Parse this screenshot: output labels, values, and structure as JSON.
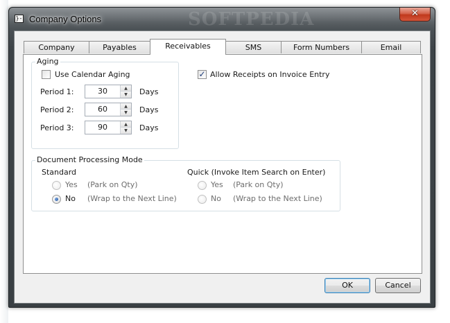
{
  "window": {
    "title": "Company Options",
    "icon": "app-icon",
    "icon_glyph": "}-",
    "watermark": "SOFTPEDIA",
    "close_glyph": "✕"
  },
  "tabs": [
    {
      "label": "Company"
    },
    {
      "label": "Payables"
    },
    {
      "label": "Receivables"
    },
    {
      "label": "SMS"
    },
    {
      "label": "Form Numbers"
    },
    {
      "label": "Email"
    }
  ],
  "active_tab": "Receivables",
  "aging": {
    "group_label": "Aging",
    "use_calendar_aging": {
      "label": "Use Calendar Aging",
      "checked": false
    },
    "periods": [
      {
        "label": "Period 1:",
        "value": "30",
        "unit": "Days"
      },
      {
        "label": "Period 2:",
        "value": "60",
        "unit": "Days"
      },
      {
        "label": "Period 3:",
        "value": "90",
        "unit": "Days"
      }
    ]
  },
  "allow_receipts": {
    "label": "Allow Receipts on Invoice Entry",
    "checked": true,
    "check_glyph": "✓"
  },
  "doc_mode": {
    "group_label": "Document Processing Mode",
    "standard": {
      "heading": "Standard",
      "options": [
        {
          "label": "Yes",
          "hint": "(Park on Qty)",
          "selected": false
        },
        {
          "label": "No",
          "hint": "(Wrap to the Next Line)",
          "selected": true
        }
      ]
    },
    "quick": {
      "heading": "Quick (Invoke Item Search on Enter)",
      "options": [
        {
          "label": "Yes",
          "hint": "(Park on Qty)",
          "selected": false
        },
        {
          "label": "No",
          "hint": "(Wrap to the Next Line)",
          "selected": false
        }
      ]
    }
  },
  "buttons": {
    "ok": "OK",
    "cancel": "Cancel"
  },
  "spin_glyphs": {
    "up": "▲",
    "down": "▼"
  }
}
